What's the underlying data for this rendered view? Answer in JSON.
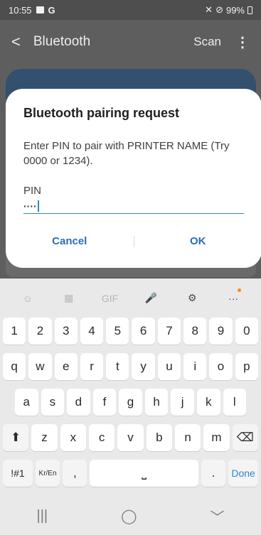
{
  "status": {
    "time": "10:55",
    "right": "99%"
  },
  "appbar": {
    "back": "<",
    "title": "Bluetooth",
    "scan": "Scan",
    "more": "⋮"
  },
  "dialog": {
    "title": "Bluetooth pairing request",
    "message": "Enter PIN to pair with PRINTER NAME (Try 0000 or 1234).",
    "pin_label": "PIN",
    "pin_value": "····",
    "cancel": "Cancel",
    "ok": "OK"
  },
  "keyboard": {
    "tools": [
      "☺",
      "▦",
      "GIF",
      "🎤",
      "⚙",
      "···"
    ],
    "row1": [
      "1",
      "2",
      "3",
      "4",
      "5",
      "6",
      "7",
      "8",
      "9",
      "0"
    ],
    "row2": [
      "q",
      "w",
      "e",
      "r",
      "t",
      "y",
      "u",
      "i",
      "o",
      "p"
    ],
    "row3": [
      "a",
      "s",
      "d",
      "f",
      "g",
      "h",
      "j",
      "k",
      "l"
    ],
    "row4": [
      "⬆",
      "z",
      "x",
      "c",
      "v",
      "b",
      "n",
      "m",
      "⌫"
    ],
    "row5": {
      "sym": "!#1",
      "lang": "Kr/En",
      "comma": ",",
      "space": "⎵",
      "period": ".",
      "done": "Done"
    }
  },
  "nav": {
    "recents": "|||",
    "home": "◯",
    "back": "﹀"
  }
}
